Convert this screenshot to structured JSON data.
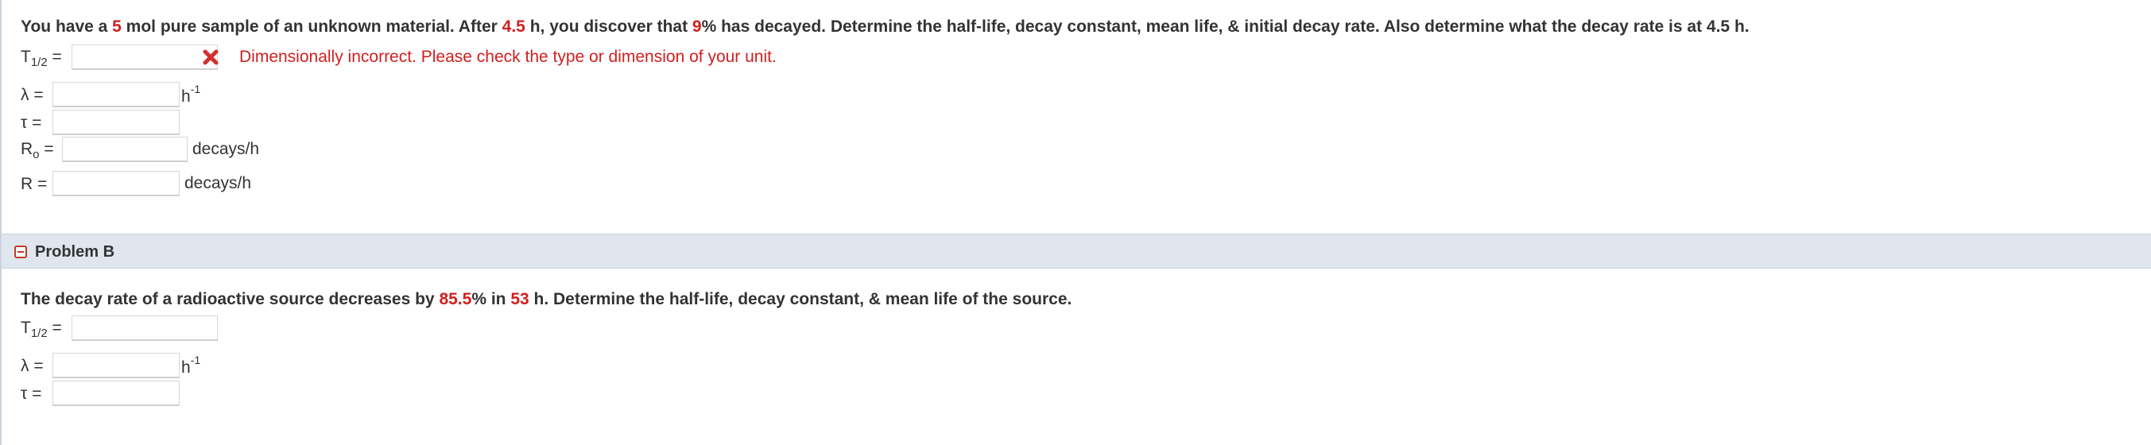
{
  "problem_a": {
    "statement": {
      "p1": "You have a ",
      "n1": "5",
      "p2": " mol pure sample of an unknown material. After ",
      "n2": "4.5",
      "p3": " h, you discover that ",
      "n3": "9",
      "p4": "% has decayed. Determine the half-life, decay constant, mean life, & initial decay rate. Also determine what the decay rate is at 4.5 h."
    },
    "half_life": {
      "label": "T",
      "label_sub": "1/2",
      "label_suffix": " =",
      "value": "",
      "error_text": "Dimensionally incorrect. Please check the type or dimension of your unit."
    },
    "decay_constant": {
      "label": "λ =",
      "value": "",
      "unit": "h",
      "unit_sup": "-1"
    },
    "mean_life": {
      "label": "τ =",
      "value": ""
    },
    "initial_rate": {
      "label": "R",
      "label_sub": "o",
      "label_suffix": " =",
      "value": "",
      "unit": "decays/h"
    },
    "rate": {
      "label": "R =",
      "value": "",
      "unit": "decays/h"
    }
  },
  "problem_b_header": {
    "title": "Problem B"
  },
  "problem_b": {
    "statement": {
      "p1": "The decay rate of a radioactive source decreases by ",
      "n1": "85.5",
      "p2": "% in ",
      "n2": "53",
      "p3": " h. Determine the half-life, decay constant, & mean life of the source."
    },
    "half_life": {
      "label": "T",
      "label_sub": "1/2",
      "label_suffix": " =",
      "value": ""
    },
    "decay_constant": {
      "label": "λ =",
      "value": "",
      "unit": "h",
      "unit_sup": "-1"
    },
    "mean_life": {
      "label": "τ =",
      "value": ""
    }
  },
  "colors": {
    "highlight": "#d02020",
    "header_bg": "#dfe6ed",
    "error": "#d02020"
  }
}
